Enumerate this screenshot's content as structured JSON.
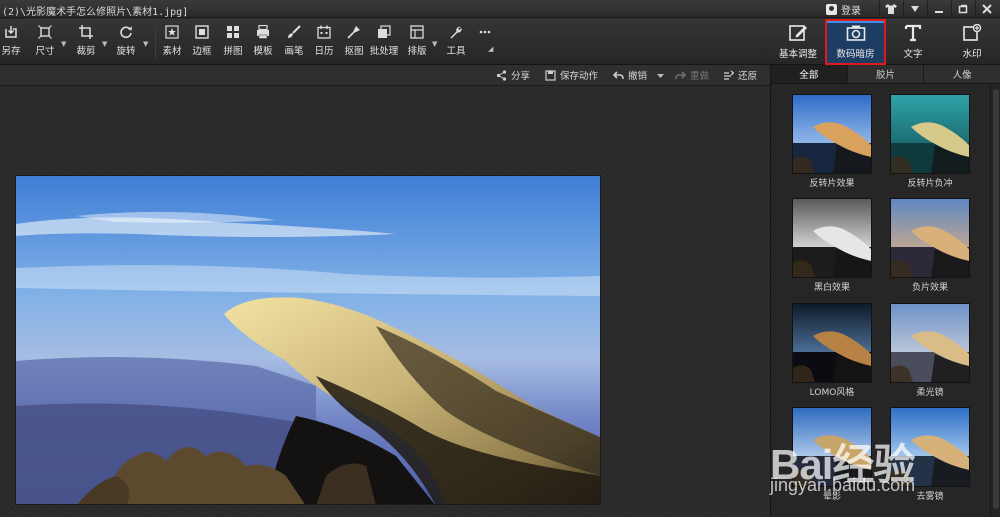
{
  "window": {
    "title": "(2)\\光影魔术手怎么修照片\\素材1.jpg]",
    "login_label": "登录",
    "buttons": [
      "shirt-icon",
      "down-arrow-icon",
      "minimize-icon",
      "maximize-icon",
      "close-icon"
    ]
  },
  "toolbar": {
    "tools": [
      {
        "label": "另存",
        "icon": "save-as-icon"
      },
      {
        "label": "尺寸",
        "icon": "resize-icon",
        "dropdown": true
      },
      {
        "label": "裁剪",
        "icon": "crop-icon",
        "dropdown": true
      },
      {
        "label": "旋转",
        "icon": "rotate-icon",
        "dropdown": true
      },
      {
        "label": "素材",
        "icon": "star-icon"
      },
      {
        "label": "边框",
        "icon": "frame-icon"
      },
      {
        "label": "拼图",
        "icon": "collage-icon"
      },
      {
        "label": "模板",
        "icon": "template-icon"
      },
      {
        "label": "画笔",
        "icon": "brush-icon"
      },
      {
        "label": "日历",
        "icon": "calendar-icon"
      },
      {
        "label": "抠图",
        "icon": "cutout-icon"
      },
      {
        "label": "批处理",
        "icon": "batch-icon"
      },
      {
        "label": "排版",
        "icon": "layout-icon",
        "dropdown": true
      },
      {
        "label": "工具",
        "icon": "wrench-icon"
      },
      {
        "label": "",
        "icon": "more-icon"
      }
    ],
    "right_tools": [
      {
        "label": "基本调整",
        "icon": "edit-icon"
      },
      {
        "label": "数码暗房",
        "icon": "camera-icon",
        "active": true
      },
      {
        "label": "文字",
        "icon": "text-icon"
      },
      {
        "label": "水印",
        "icon": "watermark-icon"
      }
    ]
  },
  "actionbar": {
    "share": "分享",
    "save_action": "保存动作",
    "undo": "撤销",
    "redo": "重做",
    "restore": "还原"
  },
  "panel": {
    "tabs": [
      "全部",
      "胶片",
      "人像"
    ],
    "active_tab": "全部",
    "effects": [
      "反转片效果",
      "反转片负冲",
      "黑白效果",
      "负片效果",
      "LOMO风格",
      "柔光镜",
      "晕影",
      "去雾镜"
    ]
  },
  "watermark": {
    "brand": "Bai经验",
    "url": "jingyan.baidu.com"
  },
  "colors": {
    "active_border": "#e01a1a",
    "active_bg": "#1e3d63",
    "highlight": "#3b8fe4"
  }
}
